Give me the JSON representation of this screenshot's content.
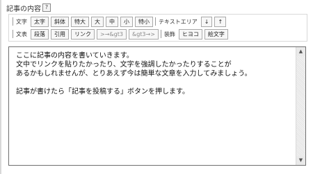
{
  "header": {
    "title": "記事の内容",
    "help": "?"
  },
  "toolbar": {
    "row1": {
      "label": "文字",
      "buttons": [
        "太字",
        "斜体",
        "特大",
        "大",
        "中",
        "小",
        "特小"
      ],
      "textarea_label": "テキストエリア",
      "arrow_down": "↓",
      "arrow_up": "↑"
    },
    "row2": {
      "label": "文表",
      "buttons": [
        "段落",
        "引用",
        "リンク"
      ],
      "dim_buttons": [
        ">→&gt3",
        "&gt3→>"
      ],
      "decor_label": "装飾",
      "decor_buttons": [
        "ヒヨコ",
        "絵文字"
      ]
    }
  },
  "editor": {
    "content": "ここに記事の内容を書いていきます。\n文中でリンクを貼りたかったり、文字を強調したかったりすることが\nあるかもしれませんが、とりあえず今は簡単な文章を入力してみましょう。\n\n記事が書けたら「記事を投稿する」ボタンを押します。"
  }
}
